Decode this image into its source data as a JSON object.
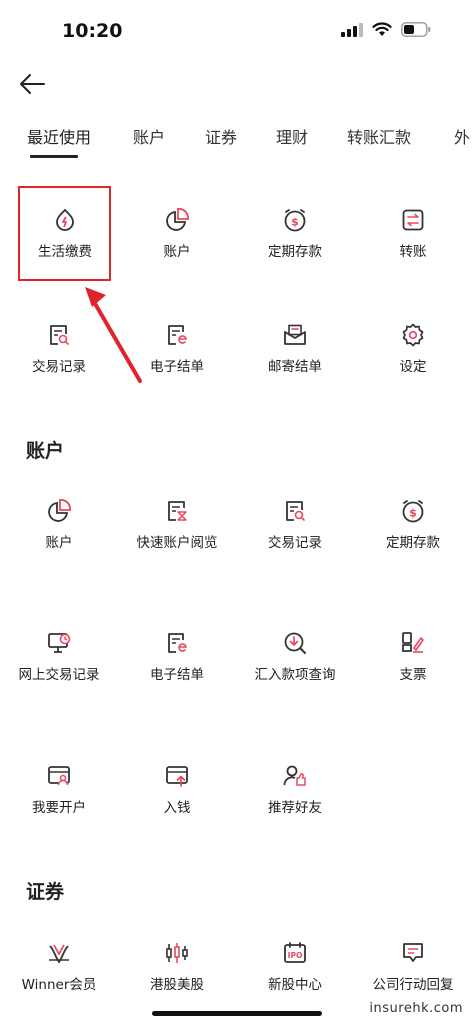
{
  "status": {
    "time": "10:20"
  },
  "tabs": [
    "最近使用",
    "账户",
    "证券",
    "理财",
    "转账汇款",
    "外"
  ],
  "recent": {
    "items": [
      {
        "label": "生活缴费",
        "icon": "bill-payment-icon"
      },
      {
        "label": "账户",
        "icon": "account-pie-icon"
      },
      {
        "label": "定期存款",
        "icon": "time-deposit-icon"
      },
      {
        "label": "转账",
        "icon": "transfer-icon"
      },
      {
        "label": "交易记录",
        "icon": "transaction-record-icon"
      },
      {
        "label": "电子结单",
        "icon": "e-statement-icon"
      },
      {
        "label": "邮寄结单",
        "icon": "mail-statement-icon"
      },
      {
        "label": "设定",
        "icon": "settings-gear-icon"
      }
    ]
  },
  "account_section": {
    "title": "账户",
    "items": [
      {
        "label": "账户",
        "icon": "account-pie-icon"
      },
      {
        "label": "快速账户阅览",
        "icon": "quick-account-view-icon"
      },
      {
        "label": "交易记录",
        "icon": "transaction-record-icon"
      },
      {
        "label": "定期存款",
        "icon": "time-deposit-icon"
      },
      {
        "label": "网上交易记录",
        "icon": "online-transaction-icon"
      },
      {
        "label": "电子结单",
        "icon": "e-statement-icon"
      },
      {
        "label": "汇入款项查询",
        "icon": "inward-remittance-icon"
      },
      {
        "label": "支票",
        "icon": "cheque-icon"
      },
      {
        "label": "我要开户",
        "icon": "open-account-icon"
      },
      {
        "label": "入钱",
        "icon": "deposit-money-icon"
      },
      {
        "label": "推荐好友",
        "icon": "refer-friend-icon"
      }
    ]
  },
  "securities_section": {
    "title": "证券",
    "items": [
      {
        "label": "Winner会员",
        "icon": "winner-member-icon"
      },
      {
        "label": "港股美股",
        "icon": "stock-candlestick-icon"
      },
      {
        "label": "新股中心",
        "icon": "ipo-center-icon"
      },
      {
        "label": "公司行动回复",
        "icon": "corporate-action-icon"
      }
    ]
  },
  "colors": {
    "accent": "#e8485f",
    "highlight": "#e0242c",
    "text": "#222222"
  },
  "watermark": "insurehk.com"
}
